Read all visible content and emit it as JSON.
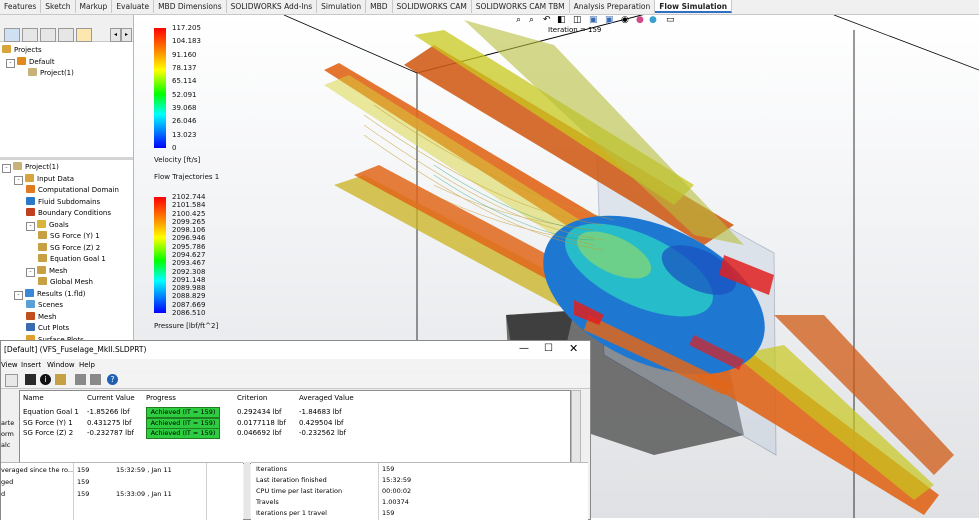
{
  "tabs": [
    "Features",
    "Sketch",
    "Markup",
    "Evaluate",
    "MBD Dimensions",
    "SOLIDWORKS Add-Ins",
    "Simulation",
    "MBD",
    "SOLIDWORKS CAM",
    "SOLIDWORKS CAM TBM",
    "Analysis Preparation",
    "Flow Simulation"
  ],
  "active_tab": "Flow Simulation",
  "tree_top": {
    "root": "Projects",
    "default": "Default",
    "project": "Project(1)"
  },
  "tree_main": [
    {
      "label": "Project(1)",
      "indent": 0
    },
    {
      "label": "Input Data",
      "indent": 1
    },
    {
      "label": "Computational Domain",
      "indent": 2
    },
    {
      "label": "Fluid Subdomains",
      "indent": 2
    },
    {
      "label": "Boundary Conditions",
      "indent": 2
    },
    {
      "label": "Goals",
      "indent": 2
    },
    {
      "label": "SG Force (Y) 1",
      "indent": 3
    },
    {
      "label": "SG Force (Z) 2",
      "indent": 3
    },
    {
      "label": "Equation Goal 1",
      "indent": 3
    },
    {
      "label": "Mesh",
      "indent": 2
    },
    {
      "label": "Global Mesh",
      "indent": 3
    },
    {
      "label": "Results (1.fld)",
      "indent": 1
    },
    {
      "label": "Scenes",
      "indent": 2
    },
    {
      "label": "Mesh",
      "indent": 2
    },
    {
      "label": "Cut Plots",
      "indent": 2
    },
    {
      "label": "Surface Plots",
      "indent": 2
    }
  ],
  "viewport": {
    "iteration_label": "Iteration = 159",
    "velocity_legend": {
      "ticks": [
        "117.205",
        "104.183",
        "91.160",
        "78.137",
        "65.114",
        "52.091",
        "39.068",
        "26.046",
        "13.023",
        "0"
      ],
      "title": "Velocity [ft/s]"
    },
    "trajectories_title": "Flow Trajectories 1",
    "pressure_legend": {
      "ticks": [
        "2102.744",
        "2101.584",
        "2100.425",
        "2099.265",
        "2098.106",
        "2096.946",
        "2095.786",
        "2094.627",
        "2093.467",
        "2092.308",
        "2091.148",
        "2089.988",
        "2088.829",
        "2087.669",
        "2086.510"
      ],
      "title": "Pressure [lbf/ft^2]"
    },
    "colors": {
      "stream_orange": "#e0661a",
      "stream_yellow": "#c8c81e",
      "body_blue": "#1e78d2",
      "body_cyan": "#28c8c8"
    }
  },
  "dialog": {
    "title": "[Default] (VFS_Fuselage_MkII.SLDPRT)",
    "menu": [
      "View",
      "Insert",
      "Window",
      "Help"
    ],
    "headers": [
      "Name",
      "Current Value",
      "Progress",
      "Criterion",
      "Averaged Value"
    ],
    "rows": [
      {
        "name": "Equation Goal 1",
        "current": "-1.85266 lbf",
        "progress": "Achieved (IT = 159)",
        "criterion": "0.292434 lbf",
        "averaged": "-1.84683 lbf"
      },
      {
        "name": "SG Force (Y) 1",
        "current": "0.431275 lbf",
        "progress": "Achieved (IT = 159)",
        "criterion": "0.0177118 lbf",
        "averaged": "0.429504 lbf"
      },
      {
        "name": "SG Force (Z) 2",
        "current": "-0.232787 lbf",
        "progress": "Achieved (IT = 159)",
        "criterion": "0.046692 lbf",
        "averaged": "-0.232562 lbf"
      }
    ],
    "left_fragments": [
      "arte",
      "orm",
      "alc"
    ],
    "left_table": [
      {
        "label": "veraged since the ro...",
        "value": "159",
        "extra": "15:32:59 , Jan 11"
      },
      {
        "label": "ged",
        "value": "159",
        "extra": ""
      },
      {
        "label": "d",
        "value": "159",
        "extra": "15:33:09 , Jan 11"
      }
    ],
    "info_table": [
      {
        "label": "Iterations",
        "value": "159"
      },
      {
        "label": "Last iteration finished",
        "value": "15:32:59"
      },
      {
        "label": "CPU time per last iteration",
        "value": "00:00:02"
      },
      {
        "label": "Travels",
        "value": "1.00374"
      },
      {
        "label": "Iterations per 1 travel",
        "value": "159"
      }
    ]
  }
}
